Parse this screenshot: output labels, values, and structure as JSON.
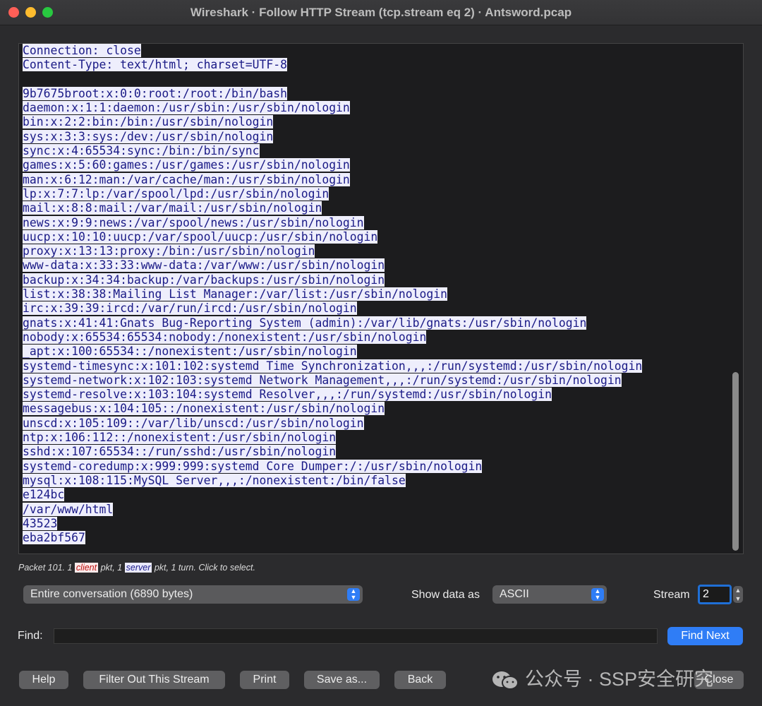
{
  "window": {
    "title": "Wireshark · Follow HTTP Stream (tcp.stream eq 2) · Antsword.pcap"
  },
  "stream_lines": [
    "Connection: close",
    "Content-Type: text/html; charset=UTF-8",
    "",
    "9b7675broot:x:0:0:root:/root:/bin/bash",
    "daemon:x:1:1:daemon:/usr/sbin:/usr/sbin/nologin",
    "bin:x:2:2:bin:/bin:/usr/sbin/nologin",
    "sys:x:3:3:sys:/dev:/usr/sbin/nologin",
    "sync:x:4:65534:sync:/bin:/bin/sync",
    "games:x:5:60:games:/usr/games:/usr/sbin/nologin",
    "man:x:6:12:man:/var/cache/man:/usr/sbin/nologin",
    "lp:x:7:7:lp:/var/spool/lpd:/usr/sbin/nologin",
    "mail:x:8:8:mail:/var/mail:/usr/sbin/nologin",
    "news:x:9:9:news:/var/spool/news:/usr/sbin/nologin",
    "uucp:x:10:10:uucp:/var/spool/uucp:/usr/sbin/nologin",
    "proxy:x:13:13:proxy:/bin:/usr/sbin/nologin",
    "www-data:x:33:33:www-data:/var/www:/usr/sbin/nologin",
    "backup:x:34:34:backup:/var/backups:/usr/sbin/nologin",
    "list:x:38:38:Mailing List Manager:/var/list:/usr/sbin/nologin",
    "irc:x:39:39:ircd:/var/run/ircd:/usr/sbin/nologin",
    "gnats:x:41:41:Gnats Bug-Reporting System (admin):/var/lib/gnats:/usr/sbin/nologin",
    "nobody:x:65534:65534:nobody:/nonexistent:/usr/sbin/nologin",
    "_apt:x:100:65534::/nonexistent:/usr/sbin/nologin",
    "systemd-timesync:x:101:102:systemd Time Synchronization,,,:/run/systemd:/usr/sbin/nologin",
    "systemd-network:x:102:103:systemd Network Management,,,:/run/systemd:/usr/sbin/nologin",
    "systemd-resolve:x:103:104:systemd Resolver,,,:/run/systemd:/usr/sbin/nologin",
    "messagebus:x:104:105::/nonexistent:/usr/sbin/nologin",
    "unscd:x:105:109::/var/lib/unscd:/usr/sbin/nologin",
    "ntp:x:106:112::/nonexistent:/usr/sbin/nologin",
    "sshd:x:107:65534::/run/sshd:/usr/sbin/nologin",
    "systemd-coredump:x:999:999:systemd Core Dumper:/:/usr/sbin/nologin",
    "mysql:x:108:115:MySQL Server,,,:/nonexistent:/bin/false",
    "e124bc",
    "/var/www/html",
    "43523",
    "eba2bf567"
  ],
  "packet_info": {
    "prefix": "Packet 101. 1 ",
    "client_label": "client",
    "middle": " pkt, 1 ",
    "server_label": "server",
    "suffix": " pkt, 1 turn. Click to select."
  },
  "controls": {
    "conversation_select": "Entire conversation (6890 bytes)",
    "show_data_as_label": "Show data as",
    "show_data_as_value": "ASCII",
    "stream_label": "Stream",
    "stream_value": "2",
    "find_label": "Find:",
    "find_value": "",
    "find_next": "Find Next"
  },
  "buttons": {
    "help": "Help",
    "filter_out": "Filter Out This Stream",
    "print": "Print",
    "save_as": "Save as...",
    "back": "Back",
    "close": "Close"
  },
  "watermark": "公众号 · SSP安全研究",
  "colors": {
    "client_highlight": "#b11111",
    "server_text": "#1a1a86",
    "accent": "#2f7df6"
  }
}
